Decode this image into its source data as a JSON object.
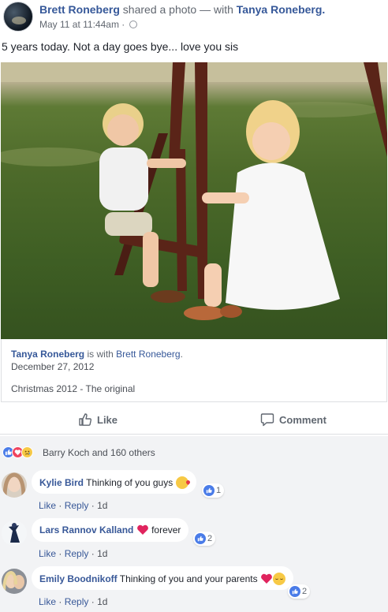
{
  "post": {
    "author": "Brett Roneberg",
    "action": "shared a photo — with",
    "tagged": "Tanya Roneberg.",
    "timestamp": "May 11 at 11:44am",
    "separator": "·",
    "text": "5 years today. Not a day goes bye... love you sis"
  },
  "shared": {
    "author": "Tanya Roneberg",
    "with_text": "is with",
    "with_name": "Brett Roneberg",
    "period": ".",
    "date": "December 27, 2012",
    "caption": "Christmas 2012 - The original"
  },
  "actions": {
    "like_label": "Like",
    "comment_label": "Comment"
  },
  "reactions": {
    "summary": "Barry Koch and 160 others",
    "icons": [
      "like-reaction-icon",
      "love-reaction-icon",
      "sad-reaction-icon"
    ]
  },
  "comments": [
    {
      "author": "Kylie Bird",
      "text": "Thinking of you guys",
      "emoji": "kiss-emoji-icon",
      "likes": "1",
      "like": "Like",
      "reply": "Reply",
      "sep": "·",
      "age": "1d"
    },
    {
      "author": "Lars Rannov Kalland",
      "text": "forever",
      "emoji": "heart-icon",
      "likes": "2",
      "like": "Like",
      "reply": "Reply",
      "sep": "·",
      "age": "1d"
    },
    {
      "author": "Emily Boodnikoff",
      "text": "Thinking of you and your parents",
      "emoji": "heart-relieved-icons",
      "likes": "2",
      "like": "Like",
      "reply": "Reply",
      "sep": "·",
      "age": "1d"
    }
  ],
  "colors": {
    "link": "#365899",
    "like_blue": "#4a7ce8",
    "love_red": "#f0445e",
    "panel_gray": "#f2f3f5"
  }
}
